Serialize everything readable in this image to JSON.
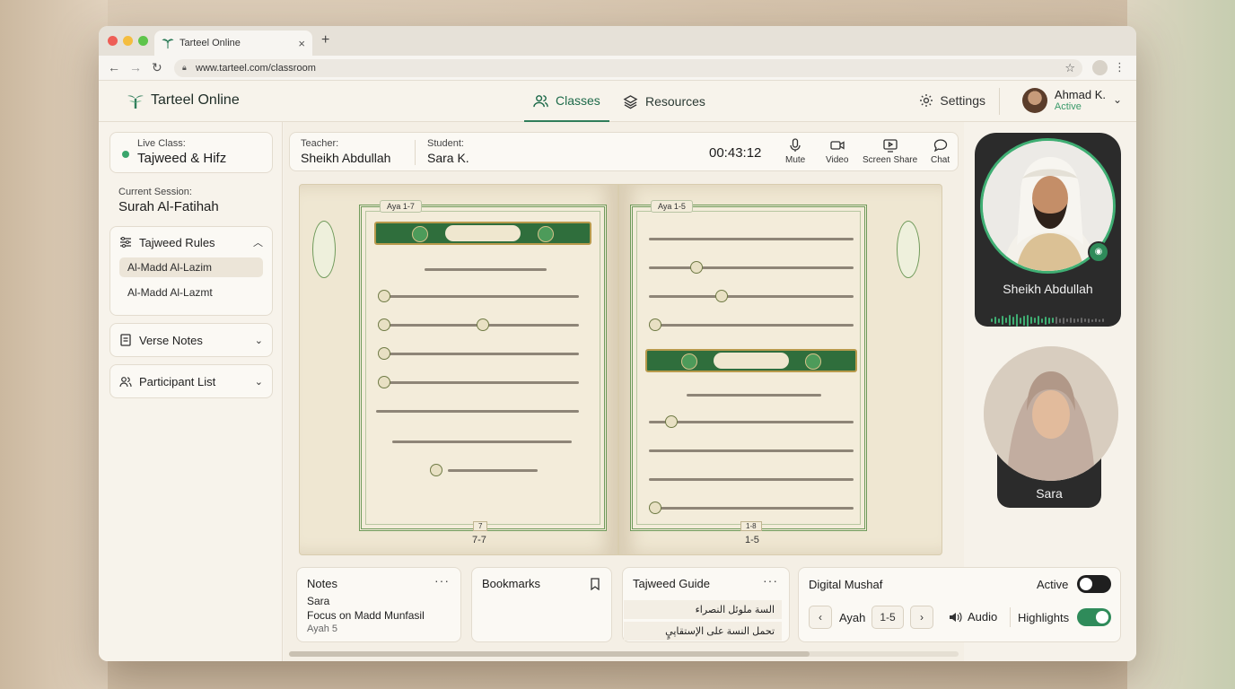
{
  "browser": {
    "tab_title": "Tarteel Online",
    "tab_close": "×",
    "new_tab": "+",
    "url": "www.tarteel.com/classroom"
  },
  "header": {
    "brand": "Tarteel Online",
    "nav": [
      {
        "label": "Classes",
        "active": true
      },
      {
        "label": "Resources",
        "active": false
      }
    ],
    "settings_label": "Settings",
    "user": {
      "name": "Ahmad K.",
      "status": "Active"
    }
  },
  "sidebar": {
    "live_class": {
      "label": "Live Class:",
      "value": "Tajweed & Hifz"
    },
    "session": {
      "label": "Current Session:",
      "value": "Surah Al-Fatihah"
    },
    "tajweed_rules": {
      "title": "Tajweed Rules",
      "items": [
        "Al-Madd Al-Lazim",
        "Al-Madd Al-Lazmt"
      ]
    },
    "verse_notes": "Verse Notes",
    "participant_list": "Participant List"
  },
  "infobar": {
    "teacher_label": "Teacher:",
    "teacher": "Sheikh Abdullah",
    "student_label": "Student:",
    "student": "Sara K.",
    "timer": "00:43:12",
    "controls": [
      "Mute",
      "Video",
      "Screen Share",
      "Chat"
    ]
  },
  "mushaf_book": {
    "left_page": {
      "aya_range": "Aya 1-7",
      "page_number": "7",
      "footer": "7-7"
    },
    "right_page": {
      "aya_range": "Aya 1-5",
      "page_number": "1-8",
      "footer": "1-5"
    }
  },
  "bottom_cards": {
    "notes": {
      "title": "Notes",
      "more": "···",
      "student": "Sara",
      "note": "Focus on Madd Munfasil",
      "ayah": "Ayah 5"
    },
    "bookmarks": {
      "title": "Bookmarks"
    },
    "tajweed_guide": {
      "title": "Tajweed Guide",
      "more": "···",
      "rows": [
        "السة ملوئل النصراء",
        "تحمل النسة على الإستقاپيٍ"
      ]
    }
  },
  "digital_mushaf": {
    "title": "Digital Mushaf",
    "active_label": "Active",
    "active_on": false,
    "ayah_label": "Ayah",
    "ayah_value": "1-5",
    "audio_label": "Audio",
    "highlights_label": "Highlights",
    "highlights_on": true
  },
  "video": {
    "teacher_name": "Sheikh Abdullah",
    "student_name": "Sara"
  },
  "colors": {
    "accent": "#2f7d5a",
    "live_dot": "#3aa56b",
    "toggle_on": "#2f8b5a",
    "toggle_off": "#1f1f1f"
  },
  "icons": [
    "logo-icon",
    "users-icon",
    "layers-icon",
    "gear-icon",
    "chevron-down-icon",
    "sliders-icon",
    "note-icon",
    "people-icon",
    "mic-icon",
    "video-icon",
    "screen-share-icon",
    "chat-icon",
    "bookmark-icon",
    "speaker-icon",
    "chevron-left-icon",
    "chevron-right-icon"
  ]
}
